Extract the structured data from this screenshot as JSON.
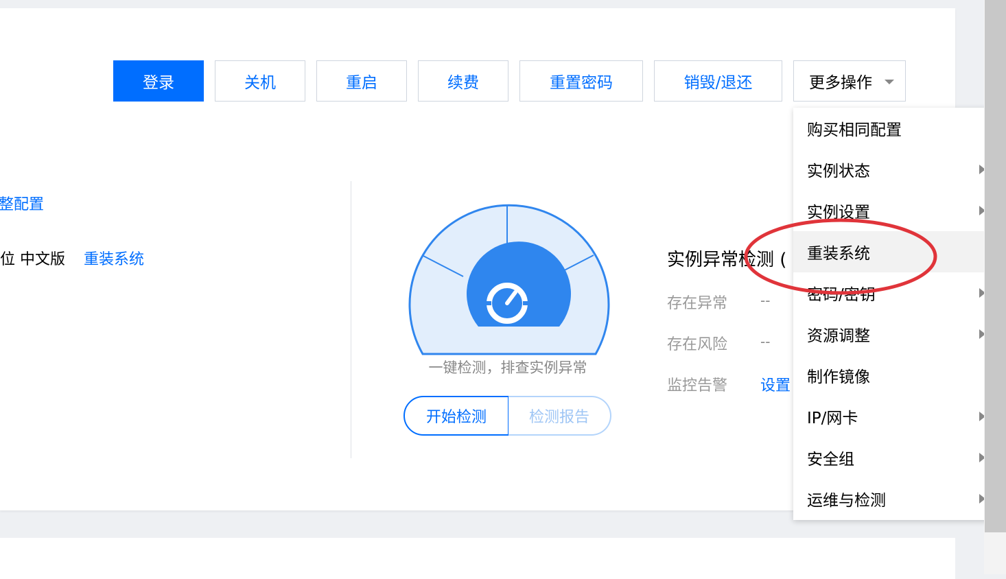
{
  "toolbar": {
    "login": "登录",
    "shutdown": "关机",
    "restart": "重启",
    "renew": "续费",
    "reset_password": "重置密码",
    "destroy": "销毁/退还",
    "more": "更多操作"
  },
  "info": {
    "adjust_config_link": "整配置",
    "os_text": "位 中文版",
    "reinstall_link": "重装系统"
  },
  "gauge": {
    "caption": "一键检测，排查实例异常",
    "start_button": "开始检测",
    "report_button": "检测报告"
  },
  "detection": {
    "title": "实例异常检测 (",
    "rows": [
      {
        "label": "存在异常",
        "value": "--"
      },
      {
        "label": "存在风险",
        "value": "--"
      },
      {
        "label": "监控告警",
        "value": "设置"
      }
    ]
  },
  "dropdown": {
    "items": [
      {
        "label": "购买相同配置",
        "submenu": false
      },
      {
        "label": "实例状态",
        "submenu": true
      },
      {
        "label": "实例设置",
        "submenu": true
      },
      {
        "label": "重装系统",
        "submenu": false
      },
      {
        "label": "密码/密钥",
        "submenu": true
      },
      {
        "label": "资源调整",
        "submenu": true
      },
      {
        "label": "制作镜像",
        "submenu": false
      },
      {
        "label": "IP/网卡",
        "submenu": true
      },
      {
        "label": "安全组",
        "submenu": true
      },
      {
        "label": "运维与检测",
        "submenu": true
      }
    ],
    "highlighted_index": 3
  },
  "colors": {
    "primary": "#006eff",
    "annotation": "#e0343a"
  }
}
